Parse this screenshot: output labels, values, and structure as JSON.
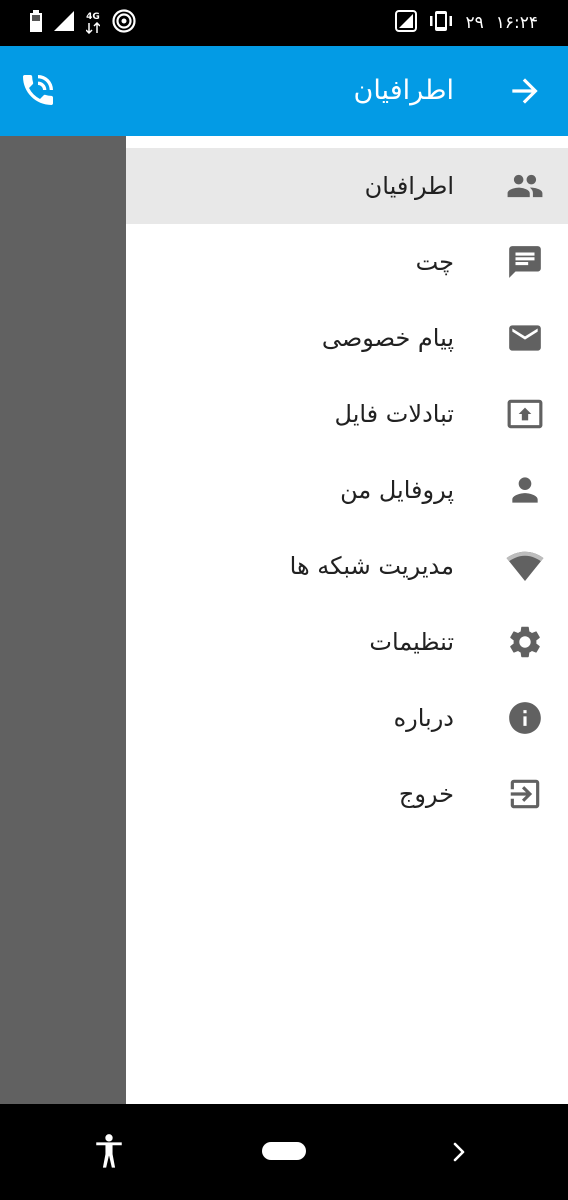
{
  "status_bar": {
    "network_type": "4G",
    "date": "۲۹",
    "time": "۱۶:۲۴"
  },
  "app_bar": {
    "title": "اطرافیان",
    "back_icon": "arrow-right-icon",
    "call_icon": "phone-call-icon"
  },
  "drawer": {
    "items": [
      {
        "label": "اطرافیان",
        "icon": "people-icon",
        "active": true
      },
      {
        "label": "چت",
        "icon": "chat-icon",
        "active": false
      },
      {
        "label": "پیام خصوصی",
        "icon": "mail-icon",
        "active": false
      },
      {
        "label": "تبادلات فایل",
        "icon": "upload-icon",
        "active": false
      },
      {
        "label": "پروفایل من",
        "icon": "person-icon",
        "active": false
      },
      {
        "label": "مدیریت شبکه ها",
        "icon": "wifi-icon",
        "active": false
      },
      {
        "label": "تنظیمات",
        "icon": "gear-icon",
        "active": false
      },
      {
        "label": "درباره",
        "icon": "info-icon",
        "active": false
      },
      {
        "label": "خروج",
        "icon": "logout-icon",
        "active": false
      }
    ]
  },
  "colors": {
    "app_bar": "#039be5",
    "scrim": "#616161",
    "active_item": "#e8e8e8",
    "icon": "#616161",
    "text": "#212121"
  }
}
